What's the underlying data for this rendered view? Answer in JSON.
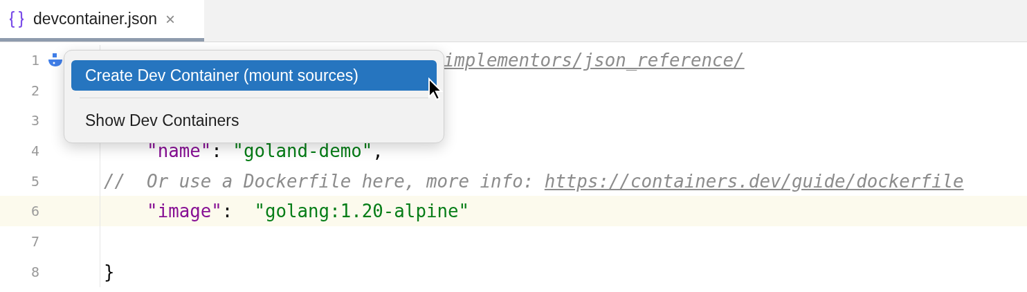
{
  "tabs": [
    {
      "label": "devcontainer.json",
      "selected": true,
      "close": "×"
    }
  ],
  "editor": {
    "lines": [
      {
        "number": "1",
        "obscured": true,
        "indented": false,
        "current": false,
        "gutter_icon": true,
        "tokens": [
          {
            "kind": "link",
            "text": "implementors/json_reference/"
          }
        ]
      },
      {
        "number": "2",
        "current": false,
        "gutter_icon": false
      },
      {
        "number": "3",
        "current": false,
        "gutter_icon": false
      },
      {
        "number": "4",
        "obscured": false,
        "indented": true,
        "current": false,
        "gutter_icon": false,
        "tokens": [
          {
            "kind": "key",
            "text": "\"name\""
          },
          {
            "kind": "punct",
            "text": ": "
          },
          {
            "kind": "string",
            "text": "\"goland-demo\""
          },
          {
            "kind": "punct",
            "text": ","
          }
        ]
      },
      {
        "number": "5",
        "obscured": false,
        "indented": false,
        "current": false,
        "gutter_icon": false,
        "tokens": [
          {
            "kind": "comment",
            "text": "//  Or use a Dockerfile here, more info: "
          },
          {
            "kind": "link",
            "text": "https://containers.dev/guide/dockerfile"
          }
        ]
      },
      {
        "number": "6",
        "obscured": false,
        "indented": true,
        "current": true,
        "gutter_icon": false,
        "tokens": [
          {
            "kind": "key",
            "text": "\"image\""
          },
          {
            "kind": "punct",
            "text": ":  "
          },
          {
            "kind": "string",
            "text": "\"golang:1.20-alpine\""
          }
        ]
      },
      {
        "number": "7",
        "current": false,
        "gutter_icon": false
      },
      {
        "number": "8",
        "obscured": false,
        "indented": false,
        "current": false,
        "gutter_icon": false,
        "tokens": [
          {
            "kind": "punct",
            "text": "}"
          }
        ]
      }
    ]
  },
  "popup_menu": {
    "items": [
      {
        "label": "Create Dev Container (mount sources)",
        "selected": true
      },
      {
        "label": "Show Dev Containers",
        "selected": false
      }
    ]
  }
}
